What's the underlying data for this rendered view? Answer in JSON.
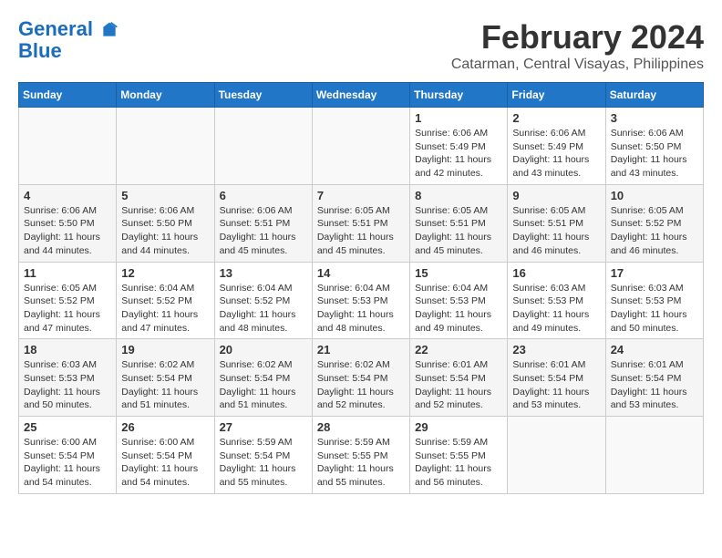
{
  "header": {
    "logo_line1": "General",
    "logo_line2": "Blue",
    "month": "February 2024",
    "location": "Catarman, Central Visayas, Philippines"
  },
  "weekdays": [
    "Sunday",
    "Monday",
    "Tuesday",
    "Wednesday",
    "Thursday",
    "Friday",
    "Saturday"
  ],
  "weeks": [
    [
      {
        "day": "",
        "content": ""
      },
      {
        "day": "",
        "content": ""
      },
      {
        "day": "",
        "content": ""
      },
      {
        "day": "",
        "content": ""
      },
      {
        "day": "1",
        "content": "Sunrise: 6:06 AM\nSunset: 5:49 PM\nDaylight: 11 hours and 42 minutes."
      },
      {
        "day": "2",
        "content": "Sunrise: 6:06 AM\nSunset: 5:49 PM\nDaylight: 11 hours and 43 minutes."
      },
      {
        "day": "3",
        "content": "Sunrise: 6:06 AM\nSunset: 5:50 PM\nDaylight: 11 hours and 43 minutes."
      }
    ],
    [
      {
        "day": "4",
        "content": "Sunrise: 6:06 AM\nSunset: 5:50 PM\nDaylight: 11 hours and 44 minutes."
      },
      {
        "day": "5",
        "content": "Sunrise: 6:06 AM\nSunset: 5:50 PM\nDaylight: 11 hours and 44 minutes."
      },
      {
        "day": "6",
        "content": "Sunrise: 6:06 AM\nSunset: 5:51 PM\nDaylight: 11 hours and 45 minutes."
      },
      {
        "day": "7",
        "content": "Sunrise: 6:05 AM\nSunset: 5:51 PM\nDaylight: 11 hours and 45 minutes."
      },
      {
        "day": "8",
        "content": "Sunrise: 6:05 AM\nSunset: 5:51 PM\nDaylight: 11 hours and 45 minutes."
      },
      {
        "day": "9",
        "content": "Sunrise: 6:05 AM\nSunset: 5:51 PM\nDaylight: 11 hours and 46 minutes."
      },
      {
        "day": "10",
        "content": "Sunrise: 6:05 AM\nSunset: 5:52 PM\nDaylight: 11 hours and 46 minutes."
      }
    ],
    [
      {
        "day": "11",
        "content": "Sunrise: 6:05 AM\nSunset: 5:52 PM\nDaylight: 11 hours and 47 minutes."
      },
      {
        "day": "12",
        "content": "Sunrise: 6:04 AM\nSunset: 5:52 PM\nDaylight: 11 hours and 47 minutes."
      },
      {
        "day": "13",
        "content": "Sunrise: 6:04 AM\nSunset: 5:52 PM\nDaylight: 11 hours and 48 minutes."
      },
      {
        "day": "14",
        "content": "Sunrise: 6:04 AM\nSunset: 5:53 PM\nDaylight: 11 hours and 48 minutes."
      },
      {
        "day": "15",
        "content": "Sunrise: 6:04 AM\nSunset: 5:53 PM\nDaylight: 11 hours and 49 minutes."
      },
      {
        "day": "16",
        "content": "Sunrise: 6:03 AM\nSunset: 5:53 PM\nDaylight: 11 hours and 49 minutes."
      },
      {
        "day": "17",
        "content": "Sunrise: 6:03 AM\nSunset: 5:53 PM\nDaylight: 11 hours and 50 minutes."
      }
    ],
    [
      {
        "day": "18",
        "content": "Sunrise: 6:03 AM\nSunset: 5:53 PM\nDaylight: 11 hours and 50 minutes."
      },
      {
        "day": "19",
        "content": "Sunrise: 6:02 AM\nSunset: 5:54 PM\nDaylight: 11 hours and 51 minutes."
      },
      {
        "day": "20",
        "content": "Sunrise: 6:02 AM\nSunset: 5:54 PM\nDaylight: 11 hours and 51 minutes."
      },
      {
        "day": "21",
        "content": "Sunrise: 6:02 AM\nSunset: 5:54 PM\nDaylight: 11 hours and 52 minutes."
      },
      {
        "day": "22",
        "content": "Sunrise: 6:01 AM\nSunset: 5:54 PM\nDaylight: 11 hours and 52 minutes."
      },
      {
        "day": "23",
        "content": "Sunrise: 6:01 AM\nSunset: 5:54 PM\nDaylight: 11 hours and 53 minutes."
      },
      {
        "day": "24",
        "content": "Sunrise: 6:01 AM\nSunset: 5:54 PM\nDaylight: 11 hours and 53 minutes."
      }
    ],
    [
      {
        "day": "25",
        "content": "Sunrise: 6:00 AM\nSunset: 5:54 PM\nDaylight: 11 hours and 54 minutes."
      },
      {
        "day": "26",
        "content": "Sunrise: 6:00 AM\nSunset: 5:54 PM\nDaylight: 11 hours and 54 minutes."
      },
      {
        "day": "27",
        "content": "Sunrise: 5:59 AM\nSunset: 5:54 PM\nDaylight: 11 hours and 55 minutes."
      },
      {
        "day": "28",
        "content": "Sunrise: 5:59 AM\nSunset: 5:55 PM\nDaylight: 11 hours and 55 minutes."
      },
      {
        "day": "29",
        "content": "Sunrise: 5:59 AM\nSunset: 5:55 PM\nDaylight: 11 hours and 56 minutes."
      },
      {
        "day": "",
        "content": ""
      },
      {
        "day": "",
        "content": ""
      }
    ]
  ]
}
